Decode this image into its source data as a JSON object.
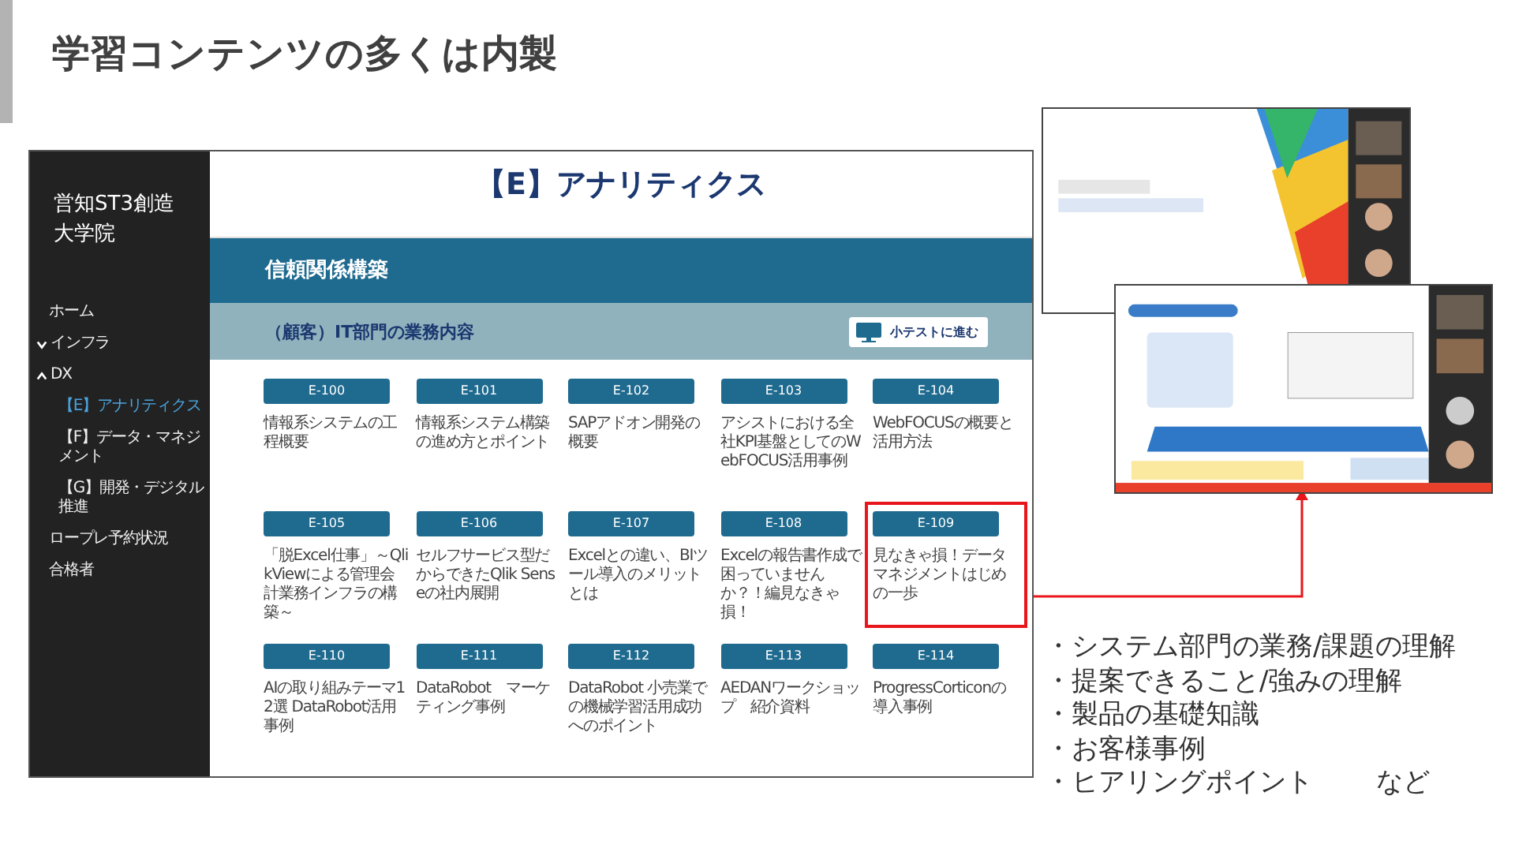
{
  "slide": {
    "title": "学習コンテンツの多くは内製"
  },
  "screen": {
    "sidebar": {
      "logo_lines": [
        "営知ST3創造",
        "大学院"
      ],
      "items": [
        {
          "kind": "link",
          "label": "ホーム",
          "selected": false
        },
        {
          "kind": "group",
          "label": "インフラ",
          "selected": false,
          "expanded": false
        },
        {
          "kind": "group",
          "label": "DX",
          "selected": false,
          "expanded": true,
          "children": [
            {
              "label": "【E】アナリティクス",
              "selected": true
            },
            {
              "label": "【F】データ・マネジメント",
              "selected": false
            },
            {
              "label": "【G】開発・デジタル推進",
              "selected": false
            }
          ]
        },
        {
          "kind": "link",
          "label": "ロープレ予約状況",
          "selected": false
        },
        {
          "kind": "link",
          "label": "合格者",
          "selected": false
        }
      ]
    },
    "page_title": "【E】アナリティクス",
    "section_title": "信頼関係構築",
    "subsection_title": "（顧客）IT部門の業務内容",
    "quiz_button": "小テストに進む",
    "cards": [
      {
        "code": "E-100",
        "text": "情報系システムの工程概要",
        "highlighted": false
      },
      {
        "code": "E-101",
        "text": "情報系システム構築の進め方とポイント",
        "highlighted": false
      },
      {
        "code": "E-102",
        "text": "SAPアドオン開発の概要",
        "highlighted": false
      },
      {
        "code": "E-103",
        "text": "アシストにおける全社KPI基盤としてのWebFOCUS活用事例",
        "highlighted": false
      },
      {
        "code": "E-104",
        "text": "WebFOCUSの概要と活用方法",
        "highlighted": false
      },
      {
        "code": "E-105",
        "text": "「脱Excel仕事」～QlikViewによる管理会計業務インフラの構築～",
        "highlighted": false
      },
      {
        "code": "E-106",
        "text": "セルフサービス型だからできたQlik Senseの社内展開",
        "highlighted": false
      },
      {
        "code": "E-107",
        "text": "Excelとの違い、BIツール導入のメリットとは",
        "highlighted": false
      },
      {
        "code": "E-108",
        "text": "Excelの報告書作成で困っていませんか？！編見なきゃ損！",
        "highlighted": false
      },
      {
        "code": "E-109",
        "text": "見なきゃ損！データマネジメントはじめの一歩",
        "highlighted": true
      },
      {
        "code": "E-110",
        "text": "AIの取り組みテーマ12選 DataRobot活用事例",
        "highlighted": false
      },
      {
        "code": "E-111",
        "text": "DataRobot　マーケティング事例",
        "highlighted": false
      },
      {
        "code": "E-112",
        "text": "DataRobot 小売業での機械学習活用成功へのポイント",
        "highlighted": false
      },
      {
        "code": "E-113",
        "text": "AEDANワークショップ　紹介資料",
        "highlighted": false
      },
      {
        "code": "E-114",
        "text": "ProgressCorticonの導入事例",
        "highlighted": false
      }
    ]
  },
  "bullets": [
    {
      "text": "・システム部門の業務/課題の理解"
    },
    {
      "text": "・提案できること/強みの理解"
    },
    {
      "text": "・製品の基礎知識"
    },
    {
      "text": "・お客様事例"
    },
    {
      "text": "・ヒアリングポイント",
      "suffix": "など"
    }
  ]
}
